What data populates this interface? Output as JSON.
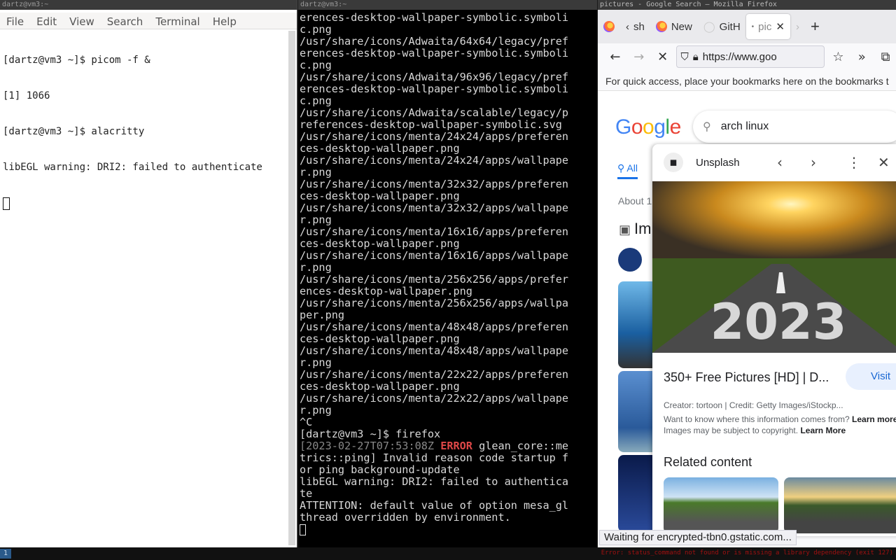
{
  "left_terminal": {
    "wm_title": "dartz@vm3:~",
    "menu": [
      "File",
      "Edit",
      "View",
      "Search",
      "Terminal",
      "Help"
    ],
    "lines": [
      "[dartz@vm3 ~]$ picom -f &",
      "[1] 1066",
      "[dartz@vm3 ~]$ alacritty",
      "libEGL warning: DRI2: failed to authenticate"
    ]
  },
  "middle_terminal": {
    "wm_title": "dartz@vm3:~",
    "lines": [
      "erences-desktop-wallpaper-symbolic.symboli",
      "c.png",
      "/usr/share/icons/Adwaita/64x64/legacy/pref",
      "erences-desktop-wallpaper-symbolic.symboli",
      "c.png",
      "/usr/share/icons/Adwaita/96x96/legacy/pref",
      "erences-desktop-wallpaper-symbolic.symboli",
      "c.png",
      "/usr/share/icons/Adwaita/scalable/legacy/p",
      "references-desktop-wallpaper-symbolic.svg",
      "/usr/share/icons/menta/24x24/apps/preferen",
      "ces-desktop-wallpaper.png",
      "/usr/share/icons/menta/24x24/apps/wallpape",
      "r.png",
      "/usr/share/icons/menta/32x32/apps/preferen",
      "ces-desktop-wallpaper.png",
      "/usr/share/icons/menta/32x32/apps/wallpape",
      "r.png",
      "/usr/share/icons/menta/16x16/apps/preferen",
      "ces-desktop-wallpaper.png",
      "/usr/share/icons/menta/16x16/apps/wallpape",
      "r.png",
      "/usr/share/icons/menta/256x256/apps/prefer",
      "ences-desktop-wallpaper.png",
      "/usr/share/icons/menta/256x256/apps/wallpa",
      "per.png",
      "/usr/share/icons/menta/48x48/apps/preferen",
      "ces-desktop-wallpaper.png",
      "/usr/share/icons/menta/48x48/apps/wallpape",
      "r.png",
      "/usr/share/icons/menta/22x22/apps/preferen",
      "ces-desktop-wallpaper.png",
      "/usr/share/icons/menta/22x22/apps/wallpape",
      "r.png",
      "^C",
      "[dartz@vm3 ~]$ firefox"
    ],
    "error_ts": "[2023-02-27T07:53:08Z",
    "error_tag": "ERROR",
    "error_rest1": "glean_core::me",
    "error_l2": "trics::ping] Invalid reason code startup f",
    "error_l3": "or ping background-update",
    "tail": [
      "libEGL warning: DRI2: failed to authentica",
      "te",
      "ATTENTION: default value of option mesa_gl",
      "thread overridden by environment."
    ]
  },
  "firefox": {
    "wm_title": "pictures - Google Search — Mozilla Firefox",
    "tabs": [
      "sh",
      "New",
      "GitH",
      "pic"
    ],
    "url": "https://www.goo",
    "bookmarks_hint": "For quick access, place your bookmarks here on the bookmarks t",
    "search_query": "arch linux",
    "all_tab": "All",
    "about": "About 1",
    "images_heading": "Im",
    "panel": {
      "source": "Unsplash",
      "title": "350+ Free Pictures [HD] | D...",
      "visit": "Visit",
      "creator": "Creator: tortoon | Credit: Getty Images/iStockp...",
      "info": "Want to know where this information comes from?",
      "learn_more_1": "Learn more",
      "copyright": "Images may be subject to copyright.",
      "learn_more_2": "Learn More",
      "related": "Related content",
      "hero_text": "2023"
    },
    "status": "Waiting for encrypted-tbn0.gstatic.com..."
  },
  "bottom_bar": {
    "workspace": "1",
    "error": "Error: status_command not found or is missing a library dependency (exit 127)"
  },
  "colors": {
    "google_blue": "#4285f4",
    "google_red": "#ea4335",
    "google_yellow": "#fbbc05",
    "google_green": "#34a853",
    "error_red": "#e04848"
  }
}
